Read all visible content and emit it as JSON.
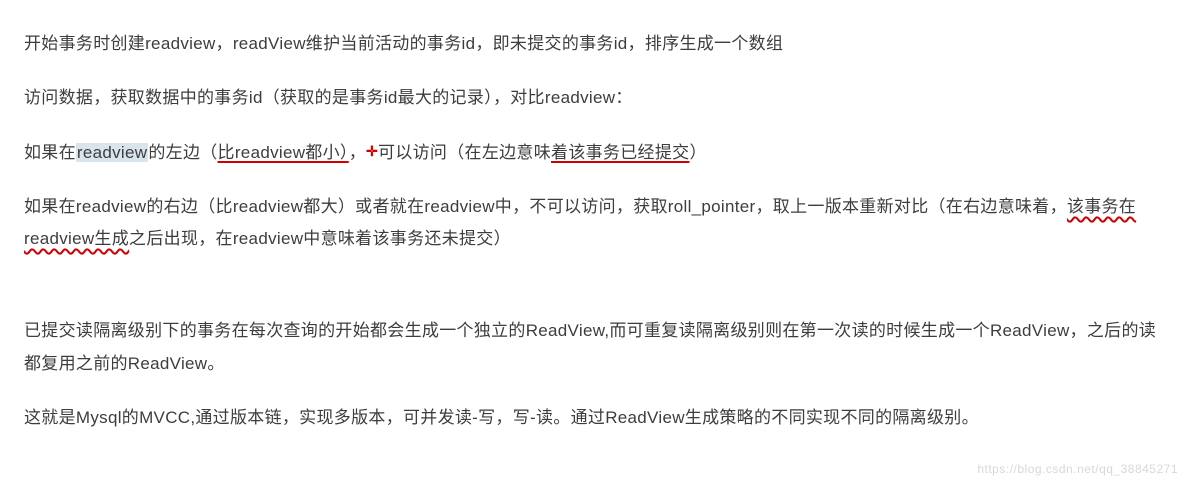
{
  "paragraphs": {
    "p1": "开始事务时创建readview，readView维护当前活动的事务id，即未提交的事务id，排序生成一个数组",
    "p2": "访问数据，获取数据中的事务id（获取的是事务id最大的记录），对比readview：",
    "p3": {
      "seg1": "如果在",
      "seg2_highlight": "readview",
      "seg3": "的左边（",
      "seg4_underline": "比readview都小）",
      "seg5": "，",
      "cross": "✛",
      "seg6": "可以访问（在左边意味",
      "seg7_underline": "着该事务已经提交",
      "seg8": "）"
    },
    "p4": {
      "line1": "如果在readview的右边（比readview都大）或者就在readview中，不可以访问，获取roll_pointer，取上一版本重新对比（在右边意味着，",
      "seg_underline": "该事务在readview生成",
      "seg_tail": "之后出现，在readview中意味着该事务还未提交）"
    },
    "p5": "已提交读隔离级别下的事务在每次查询的开始都会生成一个独立的ReadView,而可重复读隔离级别则在第一次读的时候生成一个ReadView，之后的读都复用之前的ReadView。",
    "p6": "这就是Mysql的MVCC,通过版本链，实现多版本，可并发读-写，写-读。通过ReadView生成策略的不同实现不同的隔离级别。"
  },
  "watermark": "https://blog.csdn.net/qq_38845271"
}
